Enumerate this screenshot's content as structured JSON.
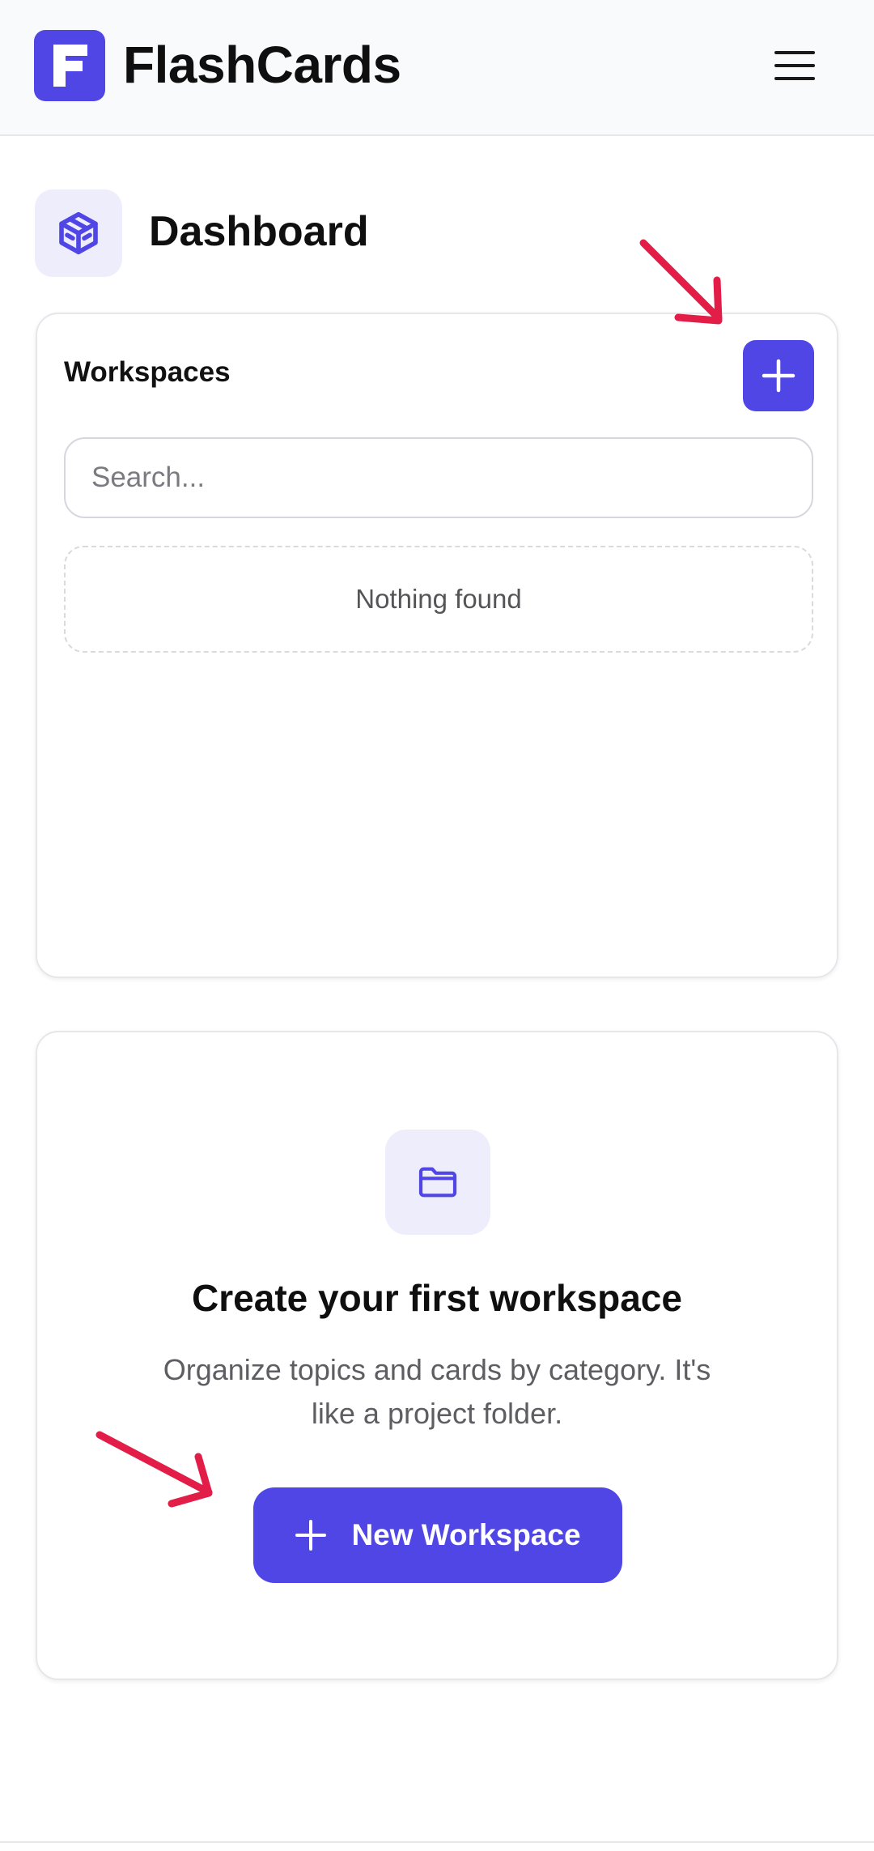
{
  "header": {
    "app_name": "FlashCards",
    "logo_icon": "flashcards-logo-icon",
    "menu_icon": "hamburger-menu-icon"
  },
  "dashboard": {
    "title": "Dashboard",
    "icon": "cube-icon"
  },
  "workspaces": {
    "title": "Workspaces",
    "add_icon": "plus-icon",
    "search_placeholder": "Search...",
    "empty_message": "Nothing found"
  },
  "create": {
    "icon": "folder-icon",
    "title": "Create your first workspace",
    "description": "Organize topics and cards by category. It's like a project folder.",
    "button_label": "New Workspace",
    "button_icon": "plus-icon"
  },
  "colors": {
    "accent": "#4f46e5",
    "accent_soft": "#eeedfc",
    "annotation_arrow": "#e11d48"
  }
}
